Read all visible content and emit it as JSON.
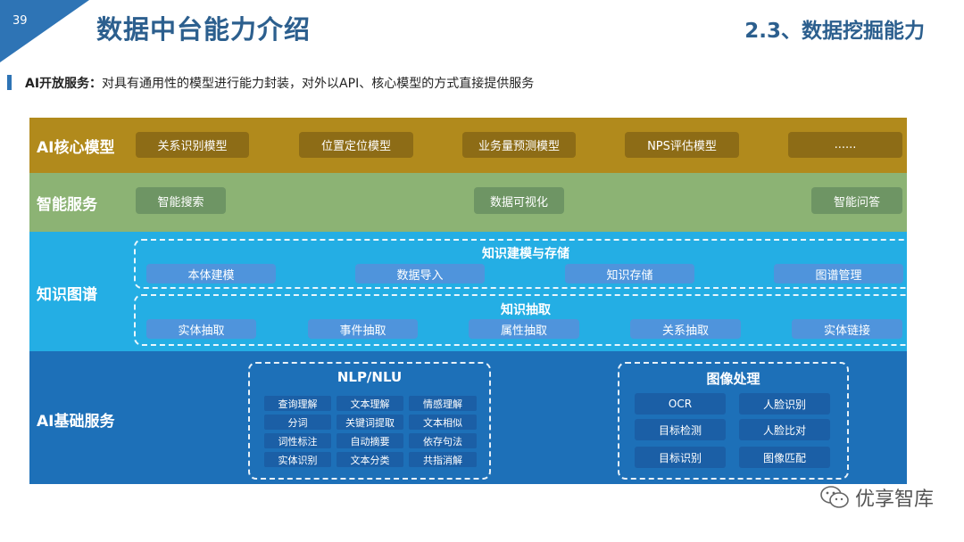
{
  "header": {
    "page_number": "39",
    "title": "数据中台能力介绍",
    "section": "2.3、数据挖掘能力"
  },
  "lead": {
    "label": "AI开放服务：",
    "text": "对具有通用性的模型进行能力封装，对外以API、核心模型的方式直接提供服务"
  },
  "layers": {
    "core": {
      "label": "AI核心模型",
      "items": [
        "关系识别模型",
        "位置定位模型",
        "业务量预测模型",
        "NPS评估模型",
        "......"
      ]
    },
    "smart": {
      "label": "智能服务",
      "items": [
        "智能搜索",
        "数据可视化",
        "智能问答"
      ]
    },
    "kg": {
      "label": "知识图谱",
      "group1": {
        "title": "知识建模与存储",
        "items": [
          "本体建模",
          "数据导入",
          "知识存储",
          "图谱管理"
        ]
      },
      "group2": {
        "title": "知识抽取",
        "items": [
          "实体抽取",
          "事件抽取",
          "属性抽取",
          "关系抽取",
          "实体链接"
        ]
      }
    },
    "base": {
      "label": "AI基础服务",
      "nlp": {
        "title": "NLP/NLU",
        "items": [
          "查询理解",
          "文本理解",
          "情感理解",
          "分词",
          "关键词提取",
          "文本相似",
          "词性标注",
          "自动摘要",
          "依存句法",
          "实体识别",
          "文本分类",
          "共指消解"
        ]
      },
      "image": {
        "title": "图像处理",
        "items": [
          "OCR",
          "人脸识别",
          "目标检测",
          "人脸比对",
          "目标识别",
          "图像匹配"
        ]
      }
    }
  },
  "watermark": {
    "text": "优享智库",
    "icon": "wechat-icon"
  }
}
